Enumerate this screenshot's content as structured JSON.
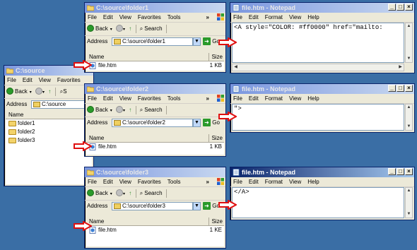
{
  "explorer_source": {
    "title": "C:\\source",
    "menu": [
      "File",
      "Edit",
      "View",
      "Favorites"
    ],
    "toolbar": {
      "back": "Back",
      "search": "S"
    },
    "address_label": "Address",
    "address_value": "C:\\source",
    "list": {
      "col_name": "Name",
      "items": [
        "folder1",
        "folder2",
        "folder3"
      ]
    }
  },
  "explorer_folder1": {
    "title": "C:\\source\\folder1",
    "menu": [
      "File",
      "Edit",
      "View",
      "Favorites",
      "Tools"
    ],
    "more": "»",
    "toolbar": {
      "back": "Back",
      "search": "Search"
    },
    "address_label": "Address",
    "address_value": "C:\\source\\folder1",
    "go": "Go",
    "list": {
      "col_name": "Name",
      "col_size": "Size",
      "file_name": "file.htm",
      "file_size": "1 KB"
    }
  },
  "explorer_folder2": {
    "title": "C:\\source\\folder2",
    "menu": [
      "File",
      "Edit",
      "View",
      "Favorites",
      "Tools"
    ],
    "more": "»",
    "toolbar": {
      "back": "Back",
      "search": "Search"
    },
    "address_label": "Address",
    "address_value": "C:\\source\\folder2",
    "go": "Go",
    "list": {
      "col_name": "Name",
      "col_size": "Size",
      "file_name": "file.htm",
      "file_size": "1 KB"
    }
  },
  "explorer_folder3": {
    "title": "C:\\source\\folder3",
    "menu": [
      "File",
      "Edit",
      "View",
      "Favorites",
      "Tools"
    ],
    "more": "»",
    "toolbar": {
      "back": "Back",
      "search": "Search"
    },
    "address_label": "Address",
    "address_value": "C:\\source\\folder3",
    "go": "Go",
    "list": {
      "col_name": "Name",
      "col_size": "Size",
      "file_name": "file.htm",
      "file_size": "1 KE"
    }
  },
  "notepad1": {
    "title": "file.htm - Notepad",
    "menu": [
      "File",
      "Edit",
      "Format",
      "View",
      "Help"
    ],
    "content": "<A style=\"COLOR: #ff0000\" href=\"mailto:"
  },
  "notepad2": {
    "title": "file.htm - Notepad",
    "menu": [
      "File",
      "Edit",
      "Format",
      "View",
      "Help"
    ],
    "content": "\">"
  },
  "notepad3": {
    "title": "file.htm - Notepad",
    "menu": [
      "File",
      "Edit",
      "Format",
      "View",
      "Help"
    ],
    "content": "</A>"
  },
  "colors": {
    "desktop": "#3a6ea5",
    "titlebar_active": "#0a246a",
    "arrow_red": "#e01010"
  }
}
